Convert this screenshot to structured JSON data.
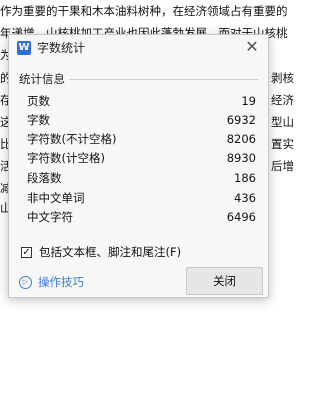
{
  "document": {
    "line1": "作为重要的干果和木本油料树种，在经济领域占有重要的",
    "line2": "年递增，山核桃加工产业也因此蓬勃发展。而对于山核桃",
    "line3_left": "为",
    "right_fragments": [
      "剥核",
      "经济",
      "型山",
      "置实",
      "后增"
    ],
    "left_fragments": [
      "的",
      "存",
      "这",
      "比",
      "活",
      "减",
      "山"
    ]
  },
  "dialog": {
    "app_icon_letter": "W",
    "title": "字数统计",
    "close_glyph": "✕",
    "group_label": "统计信息",
    "stats": [
      {
        "label": "页数",
        "value": "19"
      },
      {
        "label": "字数",
        "value": "6932"
      },
      {
        "label": "字符数(不计空格)",
        "value": "8206"
      },
      {
        "label": "字符数(计空格)",
        "value": "8930"
      },
      {
        "label": "段落数",
        "value": "186"
      },
      {
        "label": "非中文单词",
        "value": "436"
      },
      {
        "label": "中文字符",
        "value": "6496"
      }
    ],
    "checkbox_checked": true,
    "checkbox_mark": "✓",
    "checkbox_label": "包括文本框、脚注和尾注(F)",
    "help_icon_glyph": "▷",
    "help_link": "操作技巧",
    "close_button": "关闭"
  }
}
